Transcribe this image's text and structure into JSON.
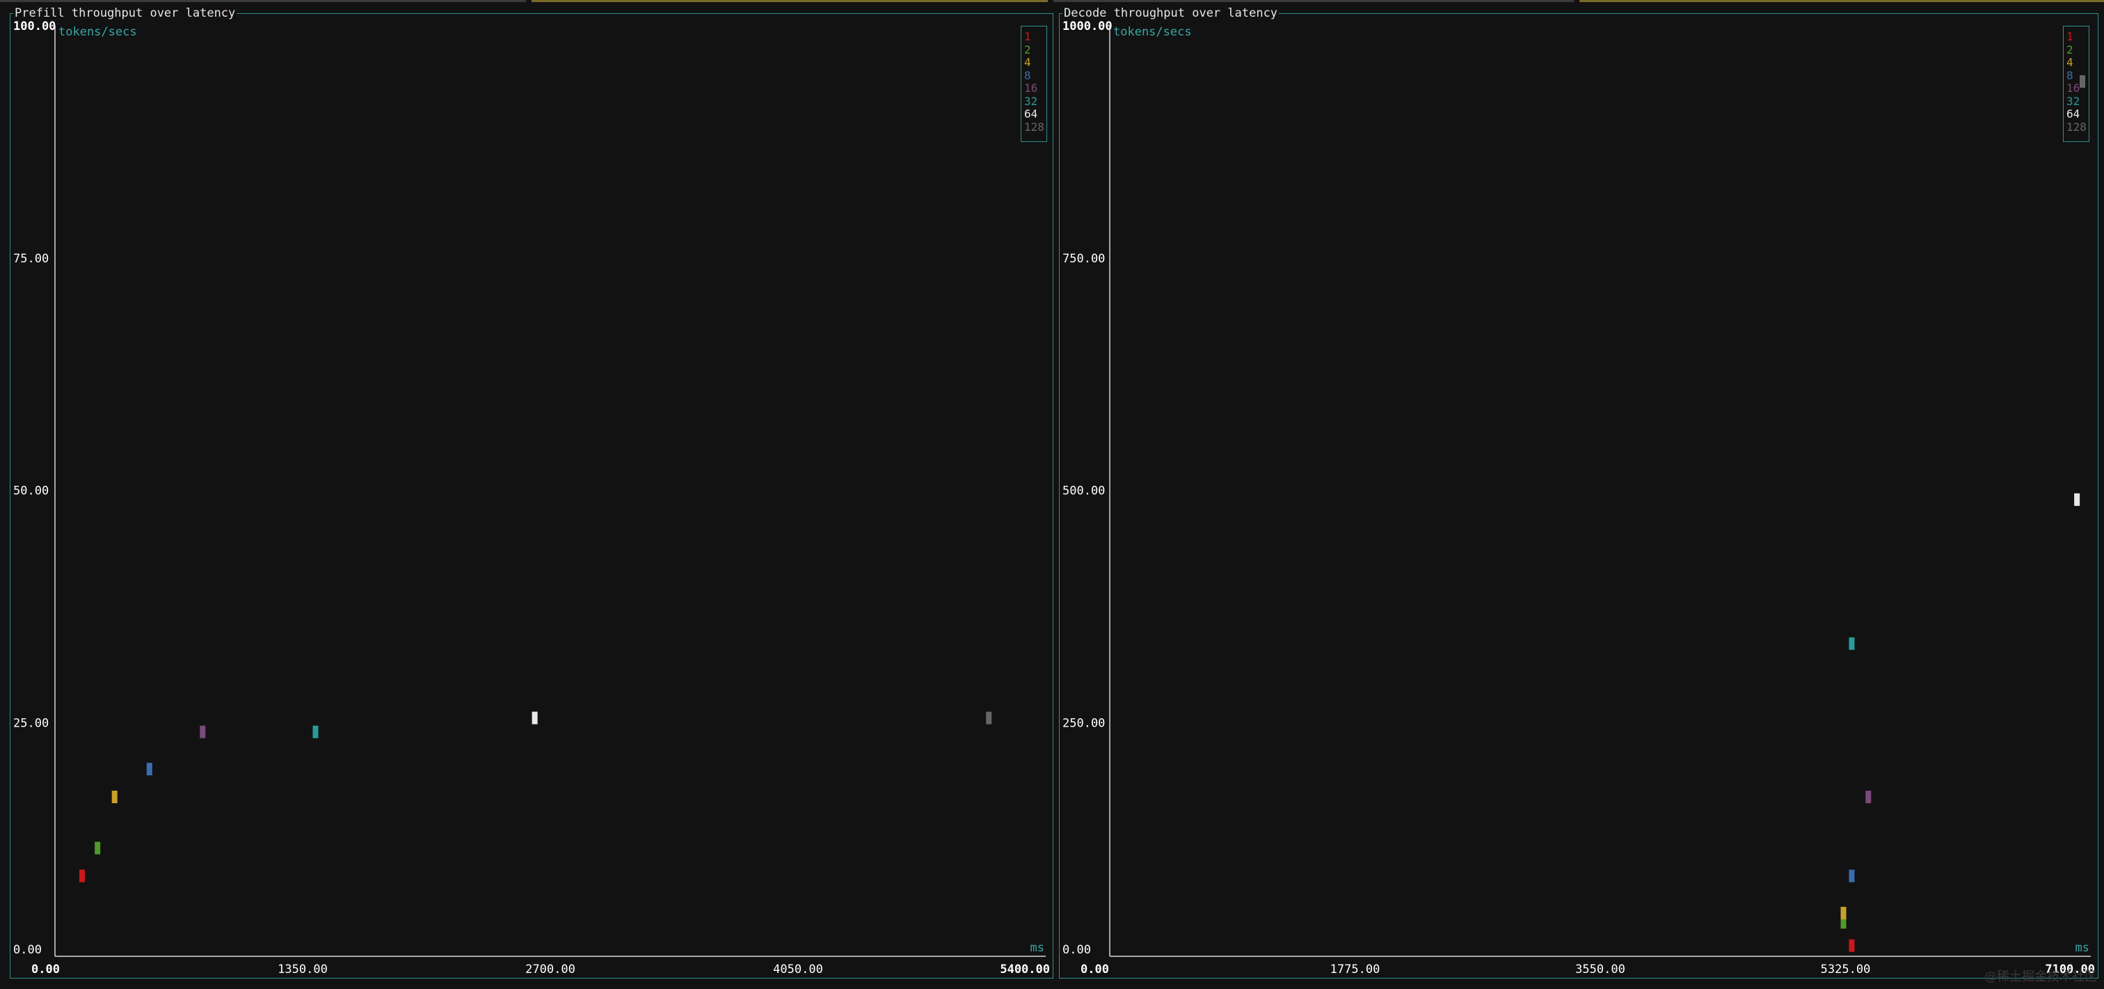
{
  "theme": {
    "background": "#121212",
    "border": "#2f8f8f",
    "axis": "#d8d8d8",
    "unit": "#3aa6a6",
    "series_colors": [
      "#c8191c",
      "#4f9a2a",
      "#c8a02a",
      "#3a6db0",
      "#7a4a7a",
      "#2a9a9a",
      "#e8e8e8",
      "#666666"
    ]
  },
  "watermark": "@稀土掘金技术社区",
  "chart_data": [
    {
      "type": "scatter",
      "title": "Prefill throughput over latency",
      "ylabel": "tokens/secs",
      "xlabel": "ms",
      "xlim": [
        0,
        5400
      ],
      "ylim": [
        0,
        100
      ],
      "xticks": [
        "0.00",
        "1350.00",
        "2700.00",
        "4050.00",
        "5400.00"
      ],
      "yticks": [
        "0.00",
        "25.00",
        "50.00",
        "75.00",
        "100.00"
      ],
      "legend_position": "top-right",
      "series": [
        {
          "name": "1",
          "x": [
            148
          ],
          "y": [
            8.5
          ]
        },
        {
          "name": "2",
          "x": [
            232
          ],
          "y": [
            11.5
          ]
        },
        {
          "name": "4",
          "x": [
            325
          ],
          "y": [
            17
          ]
        },
        {
          "name": "8",
          "x": [
            515
          ],
          "y": [
            20
          ]
        },
        {
          "name": "16",
          "x": [
            805
          ],
          "y": [
            24
          ]
        },
        {
          "name": "32",
          "x": [
            1420
          ],
          "y": [
            24
          ]
        },
        {
          "name": "64",
          "x": [
            2615
          ],
          "y": [
            25.5
          ]
        },
        {
          "name": "128",
          "x": [
            5090
          ],
          "y": [
            25.5
          ]
        }
      ]
    },
    {
      "type": "scatter",
      "title": "Decode throughput over latency",
      "ylabel": "tokens/secs",
      "xlabel": "ms",
      "xlim": [
        0,
        7100
      ],
      "ylim": [
        0,
        1000
      ],
      "xticks": [
        "0.00",
        "1775.00",
        "3550.00",
        "5325.00",
        "7100.00"
      ],
      "yticks": [
        "0.00",
        "250.00",
        "500.00",
        "750.00",
        "1000.00"
      ],
      "legend_position": "top-right",
      "series": [
        {
          "name": "1",
          "x": [
            5370
          ],
          "y": [
            10
          ]
        },
        {
          "name": "2",
          "x": [
            5310
          ],
          "y": [
            35
          ]
        },
        {
          "name": "4",
          "x": [
            5310
          ],
          "y": [
            45
          ]
        },
        {
          "name": "8",
          "x": [
            5370
          ],
          "y": [
            85
          ]
        },
        {
          "name": "16",
          "x": [
            5490
          ],
          "y": [
            170
          ]
        },
        {
          "name": "32",
          "x": [
            5370
          ],
          "y": [
            335
          ]
        },
        {
          "name": "64",
          "x": [
            7000
          ],
          "y": [
            490
          ]
        },
        {
          "name": "128",
          "x": [
            7420
          ],
          "y": [
            940
          ]
        }
      ]
    }
  ]
}
